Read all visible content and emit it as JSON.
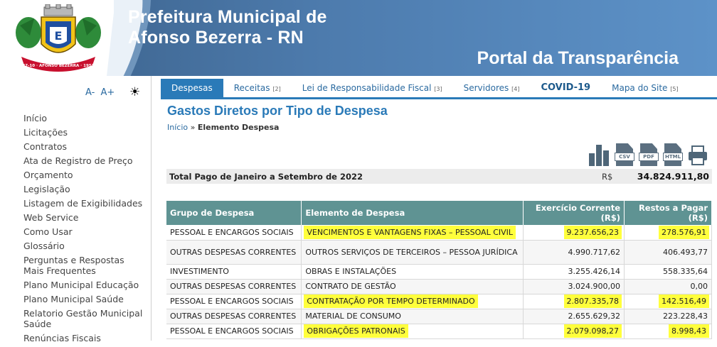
{
  "header": {
    "coat_ribbon": "27-10 AFONSO BEZERRA 1953",
    "municipality_line1": "Prefeitura Municipal de",
    "municipality_line2": "Afonso Bezerra - RN",
    "portal": "Portal da Transparência"
  },
  "accessibility": {
    "font_decrease": "A-",
    "font_increase": "A+",
    "contrast_icon": "sun-icon"
  },
  "sidebar": {
    "items": [
      "Início",
      "Licitações",
      "Contratos",
      "Ata de Registro de Preço",
      "Orçamento",
      "Legislação",
      "Listagem de Exigibilidades",
      "Web Service",
      "Como Usar",
      "Glossário",
      "Perguntas e Respostas Mais Frequentes",
      "Plano Municipal Educação",
      "Plano Municipal Saúde",
      "Relatorio Gestão Municipal Saúde",
      "Renúncias Fiscais"
    ]
  },
  "tabs": [
    {
      "label": "Despesas",
      "key": "",
      "active": true
    },
    {
      "label": "Receitas",
      "key": "[2]"
    },
    {
      "label": "Lei de Responsabilidade Fiscal",
      "key": "[3]"
    },
    {
      "label": "Servidores",
      "key": "[4]"
    },
    {
      "label": "COVID-19",
      "key": ""
    },
    {
      "label": "Mapa do Site",
      "key": "[5]"
    }
  ],
  "page": {
    "title": "Gastos Diretos por Tipo de Despesa",
    "breadcrumb_home": "Início",
    "breadcrumb_sep": "»",
    "breadcrumb_current": "Elemento Despesa"
  },
  "exports": [
    "CSV",
    "PDF",
    "HTML"
  ],
  "total": {
    "label": "Total Pago de Janeiro a Setembro de 2022",
    "currency": "R$",
    "value": "34.824.911,80"
  },
  "table": {
    "headers": {
      "grupo": "Grupo de Despesa",
      "elemento": "Elemento de Despesa",
      "exercicio": "Exercício Corrente",
      "exercicio_unit": "(R$)",
      "restos": "Restos a Pagar",
      "restos_unit": "(R$)"
    },
    "rows": [
      {
        "grupo": "PESSOAL E ENCARGOS SOCIAIS",
        "elemento": "VENCIMENTOS E VANTAGENS FIXAS – PESSOAL CIVIL",
        "exercicio": "9.237.656,23",
        "restos": "278.576,91",
        "highlight": true
      },
      {
        "grupo": "OUTRAS DESPESAS CORRENTES",
        "elemento": "OUTROS SERVIÇOS DE TERCEIROS – PESSOA JURÍDICA",
        "exercicio": "4.990.717,62",
        "restos": "406.493,77",
        "highlight": false
      },
      {
        "grupo": "INVESTIMENTO",
        "elemento": "OBRAS E INSTALAÇÕES",
        "exercicio": "3.255.426,14",
        "restos": "558.335,64",
        "highlight": false
      },
      {
        "grupo": "OUTRAS DESPESAS CORRENTES",
        "elemento": "CONTRATO DE GESTÃO",
        "exercicio": "3.024.900,00",
        "restos": "0,00",
        "highlight": false
      },
      {
        "grupo": "PESSOAL E ENCARGOS SOCIAIS",
        "elemento": "CONTRATAÇÃO POR TEMPO DETERMINADO",
        "exercicio": "2.807.335,78",
        "restos": "142.516,49",
        "highlight": true
      },
      {
        "grupo": "OUTRAS DESPESAS CORRENTES",
        "elemento": "MATERIAL DE CONSUMO",
        "exercicio": "2.655.629,32",
        "restos": "223.228,43",
        "highlight": false
      },
      {
        "grupo": "PESSOAL E ENCARGOS SOCIAIS",
        "elemento": "OBRIGAÇÕES PATRONAIS",
        "exercicio": "2.079.098,27",
        "restos": "8.998,43",
        "highlight": true
      }
    ]
  },
  "colors": {
    "header_blue": "#3a5f87",
    "accent": "#2a7ab8",
    "table_header": "#5f9393",
    "highlight": "#ffff3c"
  }
}
